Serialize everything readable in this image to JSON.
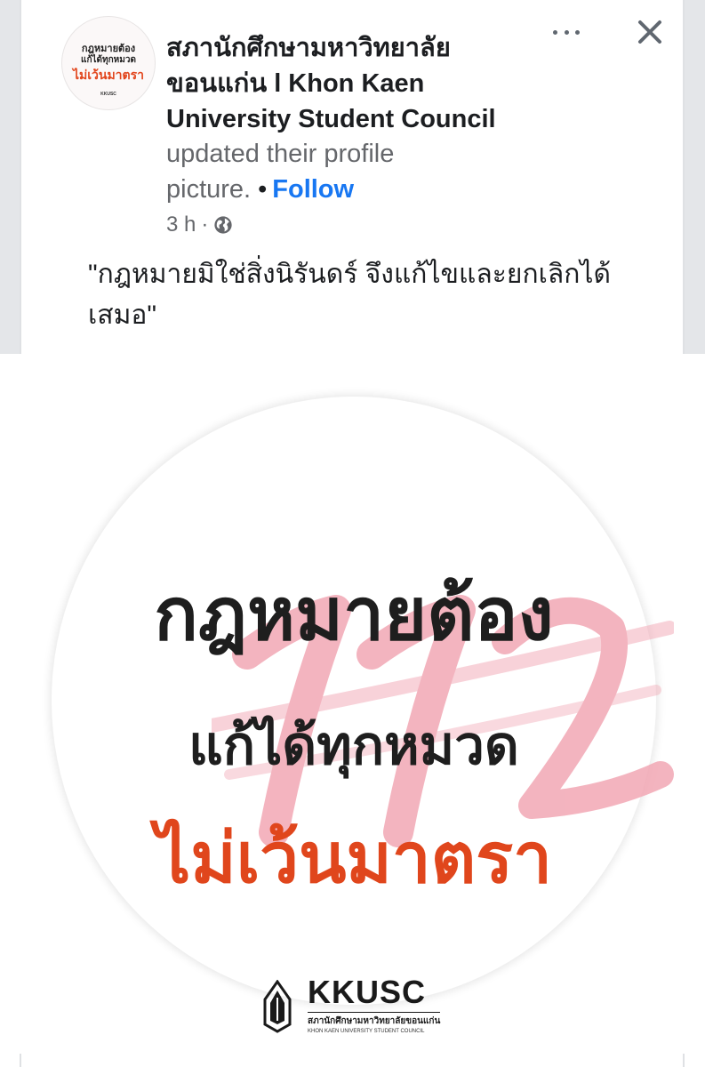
{
  "post": {
    "page_name": "สภานักศึกษามหาวิทยาลัยขอนแก่น l Khon Kaen University Student Council",
    "activity": "updated their profile picture.",
    "separator": "•",
    "follow_label": "Follow",
    "time": "3 h",
    "meta_separator": "·",
    "caption": "\"กฎหมายมิใช่สิ่งนิรันดร์ จึงแก้ไขและยกเลิกได้เสมอ\""
  },
  "avatar": {
    "line1": "กฎหมายต้อง",
    "line2": "แก้ได้ทุกหมวด",
    "line3": "ไม่เว้นมาตรา",
    "logo": "KKUSC"
  },
  "icons": {
    "more": "more-horizontal-icon",
    "close": "close-icon",
    "audience": "globe-icon"
  },
  "image": {
    "line1": "กฎหมายต้อง",
    "line2": "แก้ได้ทุกหมวด",
    "line3": "ไม่เว้นมาตรา",
    "logo_name": "KKUSC",
    "logo_th": "สภานักศึกษามหาวิทยาลัยขอนแก่น",
    "logo_en": "KHON KAEN UNIVERSITY STUDENT COUNCIL"
  },
  "colors": {
    "follow": "#1877f2",
    "accent_orange": "#e0461c",
    "brush_pink": "#f2a7b4",
    "muted_text": "#65676b"
  }
}
